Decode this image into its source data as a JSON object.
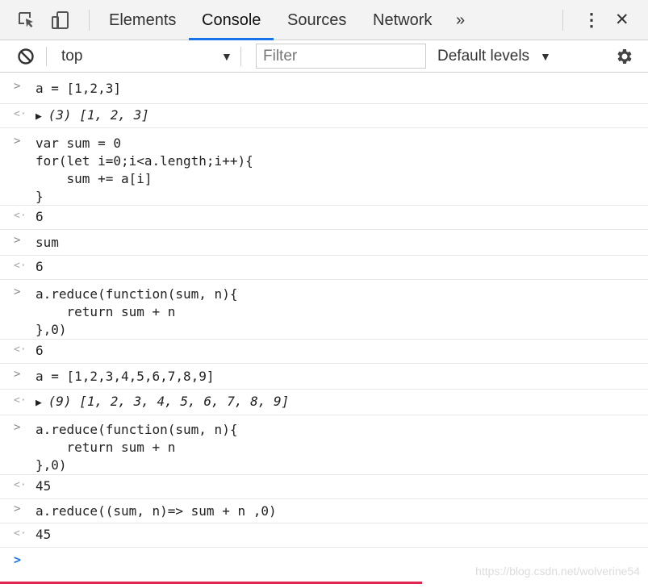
{
  "toolbar": {
    "tabs": [
      {
        "label": "Elements"
      },
      {
        "label": "Console"
      },
      {
        "label": "Sources"
      },
      {
        "label": "Network"
      }
    ],
    "overflow_label": "»",
    "menu_label": "⋮",
    "close_label": "✕"
  },
  "filterbar": {
    "context": "top",
    "filter_placeholder": "Filter",
    "levels": "Default levels",
    "dropdown_arrow": "▼"
  },
  "console": {
    "input_arrow": ">",
    "output_arrow": "<·",
    "entries": [
      {
        "input": "a = [1,2,3]",
        "output": "(3) [1, 2, 3]"
      },
      {
        "input": "var sum = 0\nfor(let i=0;i<a.length;i++){\n    sum += a[i]\n}",
        "output": "6"
      },
      {
        "input": "sum",
        "output": "6"
      },
      {
        "input": "a.reduce(function(sum, n){\n    return sum + n\n},0)",
        "output": "6"
      },
      {
        "input": "a = [1,2,3,4,5,6,7,8,9]",
        "output": "(9) [1, 2, 3, 4, 5, 6, 7, 8, 9]"
      },
      {
        "input": "a.reduce(function(sum, n){\n    return sum + n\n},0)",
        "output": "45"
      },
      {
        "input": "a.reduce((sum, n)=> sum + n ,0)",
        "output": "45"
      }
    ]
  },
  "watermark": "https://blog.csdn.net/wolverine54",
  "colors": {
    "accent": "#1a73e8",
    "number": "#1c00cf",
    "keyword": "#aa0d91",
    "bottom_bar": "#e0264f"
  }
}
